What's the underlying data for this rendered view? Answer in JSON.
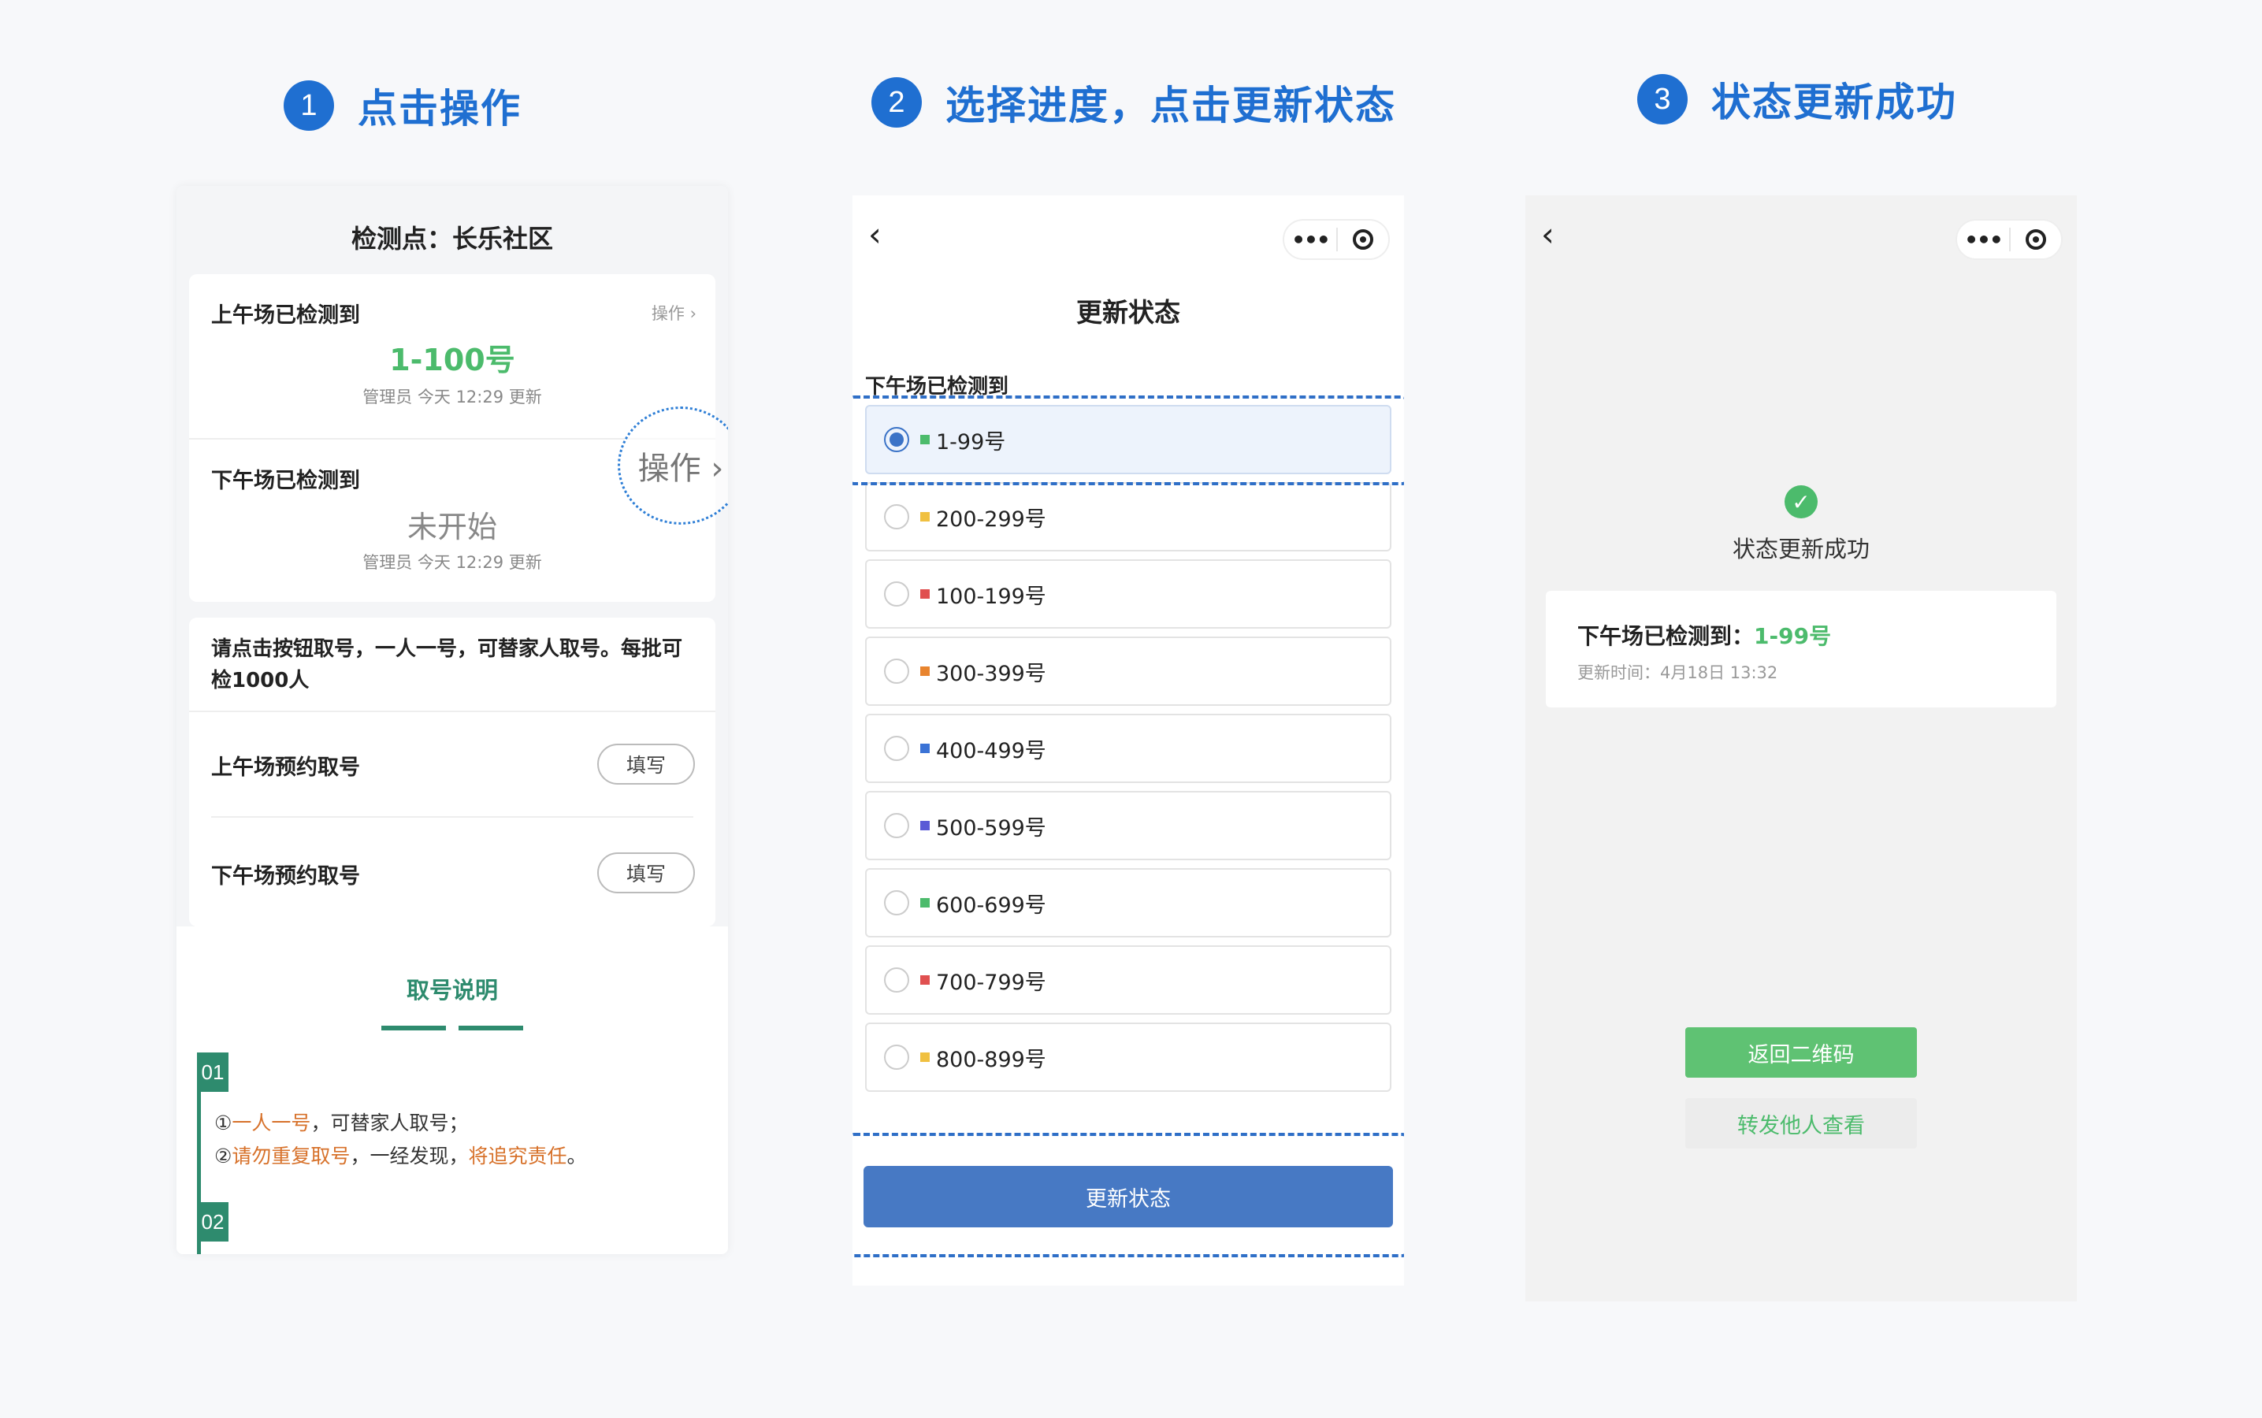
{
  "steps": [
    {
      "num": "1",
      "title": "点击操作"
    },
    {
      "num": "2",
      "title": "选择进度，点击更新状态"
    },
    {
      "num": "3",
      "title": "状态更新成功"
    }
  ],
  "phone1": {
    "title": "检测点：长乐社区",
    "morning": {
      "label": "上午场已检测到",
      "value": "1-100号",
      "meta": "管理员 今天 12:29 更新",
      "op": "操作 ›"
    },
    "afternoon": {
      "label": "下午场已检测到",
      "value": "未开始",
      "meta": "管理员 今天 12:29 更新"
    },
    "op_highlight": "操作 ›",
    "notice": "请点击按钮取号，一人一号，可替家人取号。每批可检1000人",
    "reserve_am": "上午场预约取号",
    "reserve_pm": "下午场预约取号",
    "fill_label": "填写",
    "intro_title": "取号说明",
    "tag1": "01",
    "tag2": "02",
    "rule1": {
      "a": "①",
      "b": "一人一号",
      "c": "，可替家人取号；"
    },
    "rule2": {
      "a": "②",
      "b": "请勿重复取号",
      "c": "，一经发现，",
      "d": "将追究责任",
      "e": "。"
    }
  },
  "phone2": {
    "back": "‹",
    "dots": "•••",
    "title": "更新状态",
    "subtitle": "下午场已检测到",
    "options": [
      {
        "label": "1-99号",
        "color": "#4cbb6c",
        "selected": true
      },
      {
        "label": "200-299号",
        "color": "#f0c040"
      },
      {
        "label": "100-199号",
        "color": "#e05050"
      },
      {
        "label": "300-399号",
        "color": "#e8842e"
      },
      {
        "label": "400-499号",
        "color": "#3b73d6"
      },
      {
        "label": "500-599号",
        "color": "#5a5ad6"
      },
      {
        "label": "600-699号",
        "color": "#4cbb6c"
      },
      {
        "label": "700-799号",
        "color": "#e05050"
      },
      {
        "label": "800-899号",
        "color": "#f0c040"
      }
    ],
    "update_button": "更新状态"
  },
  "phone3": {
    "back": "‹",
    "dots": "•••",
    "success": "状态更新成功",
    "result_label": "下午场已检测到：",
    "result_value": "1-99号",
    "time": "更新时间：4月18日 13:32",
    "back_qr": "返回二维码",
    "forward": "转发他人查看"
  }
}
